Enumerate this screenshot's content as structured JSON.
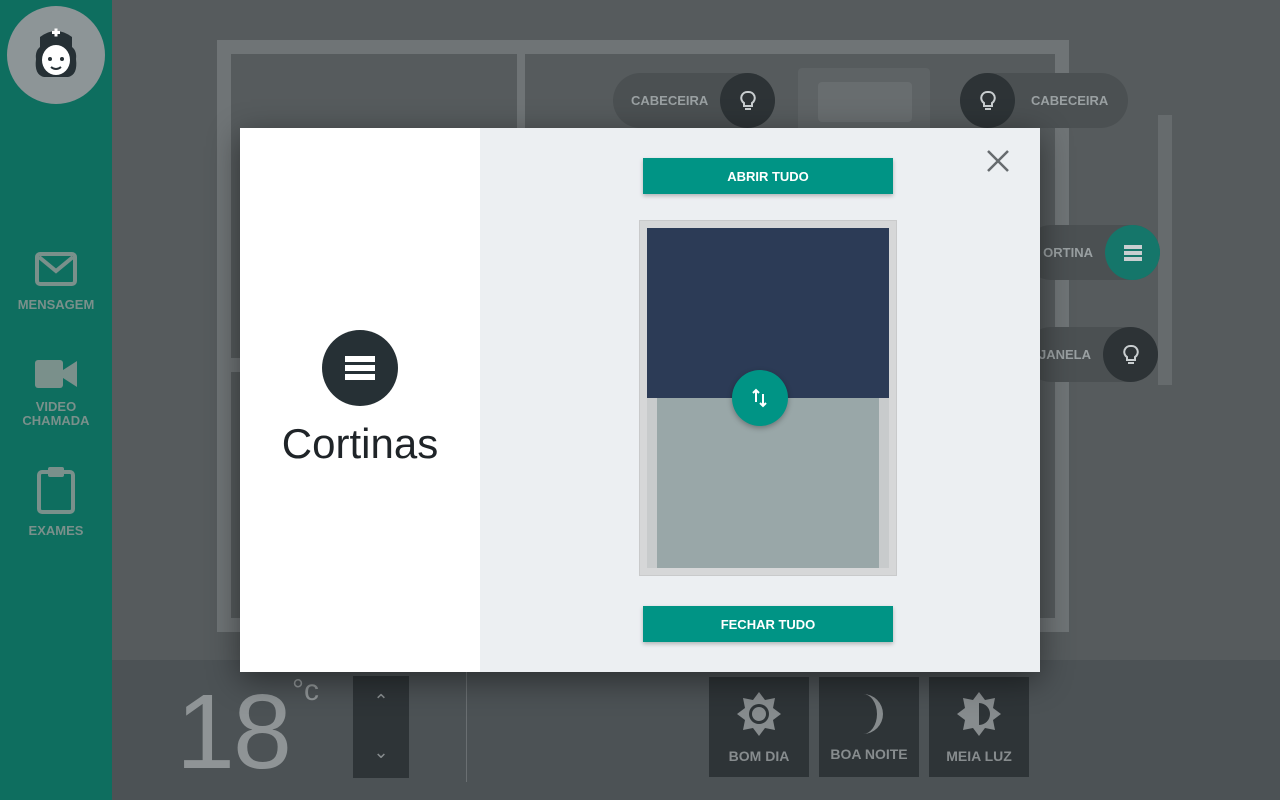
{
  "sidebar": {
    "items": [
      {
        "label": "MENSAGEM",
        "icon": "mail-icon"
      },
      {
        "label": "VIDEO CHAMADA",
        "icon": "video-camera-icon"
      },
      {
        "label": "EXAMES",
        "icon": "clipboard-icon"
      }
    ]
  },
  "plan": {
    "chips": [
      {
        "label": "CABECEIRA",
        "icon": "lightbulb-icon"
      },
      {
        "label": "CABECEIRA",
        "icon": "lightbulb-icon"
      },
      {
        "label": "ORTINA",
        "icon": "curtain-icon"
      },
      {
        "label": "JANELA",
        "icon": "lightbulb-icon"
      }
    ]
  },
  "bottom": {
    "temperature": "18",
    "unit": "°c",
    "scenes": [
      {
        "label": "BOM DIA",
        "icon": "sun-icon"
      },
      {
        "label": "BOA NOITE",
        "icon": "moon-icon"
      },
      {
        "label": "MEIA LUZ",
        "icon": "half-brightness-icon"
      }
    ]
  },
  "modal": {
    "title": "Cortinas",
    "open_all": "ABRIR TUDO",
    "close_all": "FECHAR TUDO",
    "curtain_closed_fraction": 0.5
  },
  "colors": {
    "accent": "#009485",
    "sidebar": "#0e6e5f",
    "shade": "#2c3b56"
  }
}
